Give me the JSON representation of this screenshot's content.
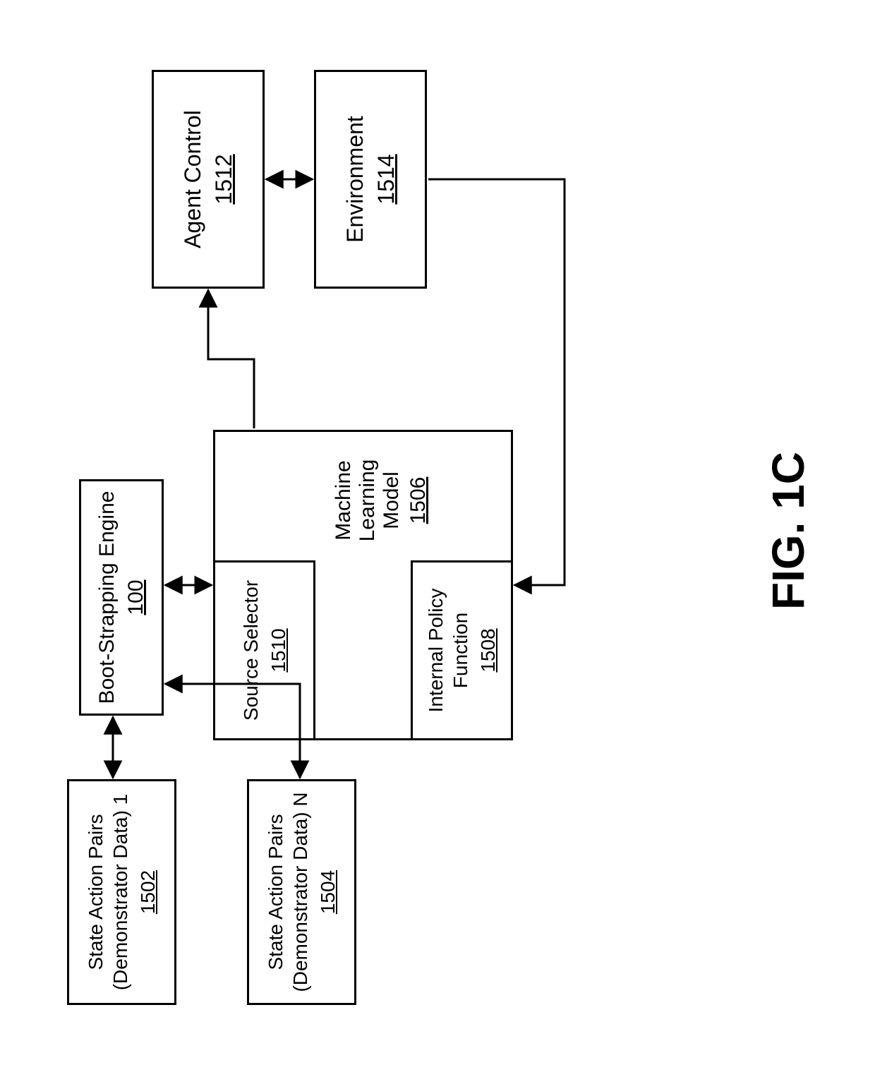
{
  "diagram": {
    "sap1": {
      "title": "State Action Pairs\n(Demonstrator Data) 1",
      "ref": "1502"
    },
    "sapN": {
      "title": "State Action Pairs\n(Demonstrator Data) N",
      "ref": "1504"
    },
    "boot": {
      "title": "Boot-Strapping Engine",
      "ref": "100"
    },
    "ml": {
      "title": "Machine Learning Model",
      "ref": "1506"
    },
    "src": {
      "title": "Source Selector",
      "ref": "1510"
    },
    "pol": {
      "title": "Internal Policy\nFunction",
      "ref": "1508"
    },
    "agent": {
      "title": "Agent Control",
      "ref": "1512"
    },
    "env": {
      "title": "Environment",
      "ref": "1514"
    }
  },
  "figure_label": "FIG. 1C"
}
